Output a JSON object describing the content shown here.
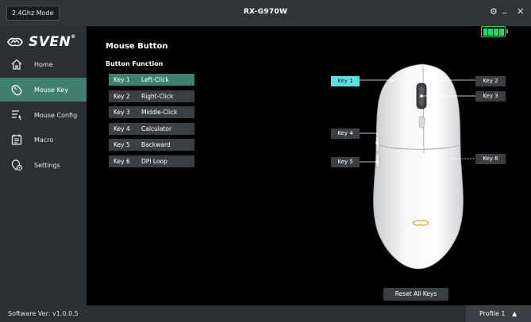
{
  "titlebar": {
    "mode": "2.4Ghz Mode",
    "title": "RX-G970W",
    "settings_glyph": "⚙",
    "minimize_glyph": "_",
    "close_glyph": "✕"
  },
  "sidebar": {
    "logo": "SVEN",
    "logo_mark": "®",
    "items": [
      {
        "label": "Home",
        "icon": "home-icon"
      },
      {
        "label": "Mouse Key",
        "icon": "mouse-key-icon"
      },
      {
        "label": "Mouse Config",
        "icon": "mouse-config-icon"
      },
      {
        "label": "Macro",
        "icon": "macro-icon"
      },
      {
        "label": "Settings",
        "icon": "settings-icon"
      }
    ],
    "active_index": 1
  },
  "main": {
    "page_title": "Mouse Button",
    "section_title": "Button Function",
    "keys": [
      {
        "key": "Key 1",
        "function": "Left-Click"
      },
      {
        "key": "Key 2",
        "function": "Right-Click"
      },
      {
        "key": "Key 3",
        "function": "Middle-Click"
      },
      {
        "key": "Key 4",
        "function": "Calculator"
      },
      {
        "key": "Key 5",
        "function": "Backward"
      },
      {
        "key": "Key 6",
        "function": "DPI Loop"
      }
    ],
    "selected_key": "Key 1",
    "callouts": [
      "Key 1",
      "Key 2",
      "Key 3",
      "Key 4",
      "Key 5",
      "Key 6"
    ],
    "battery_level": 1.0,
    "reset_label": "Reset All Keys"
  },
  "footer": {
    "software_version": "Software Ver: v1.0.0.5",
    "profile": "Profile 1",
    "profile_glyph": "▲"
  },
  "colors": {
    "accent": "#3f7f6f",
    "selected_callout": "#5fdfe0",
    "battery": "#2fd35f"
  }
}
